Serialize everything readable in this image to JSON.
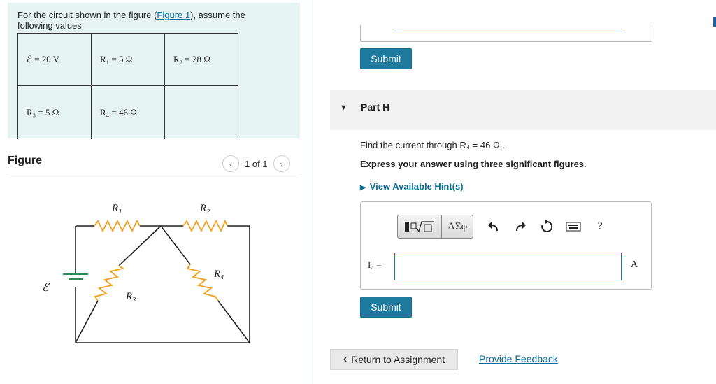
{
  "intro": {
    "text_before": "For the circuit shown in the figure (",
    "figure_link": "Figure 1",
    "text_after": "), assume the following values."
  },
  "values_table": [
    [
      "ℰ = 20 V",
      "R₁ = 5 Ω",
      "R₂ = 28 Ω"
    ],
    [
      "R₃ = 5 Ω",
      "R₄ = 46 Ω",
      ""
    ]
  ],
  "figure": {
    "label": "Figure",
    "pager_text": "1 of 1",
    "prev_icon": "chevron-left-icon",
    "next_icon": "chevron-right-icon",
    "circuit_labels": {
      "r1": "R₁",
      "r2": "R₂",
      "r3": "R₃",
      "r4": "R₄",
      "emf": "ℰ"
    }
  },
  "previous_part": {
    "submit_label": "Submit"
  },
  "part_h": {
    "title": "Part H",
    "question": "Find the current through R₄ = 46 Ω .",
    "instruction": "Express your answer using three significant figures.",
    "hints_label": "View Available Hint(s)",
    "toolbar": {
      "templates_icon": "fraction-sqrt-icon",
      "symbols_label": "ΑΣφ",
      "undo_icon": "undo-icon",
      "redo_icon": "redo-icon",
      "reset_icon": "reset-icon",
      "keyboard_icon": "keyboard-icon",
      "help_label": "?"
    },
    "variable_label": "I₄ =",
    "answer_value": "",
    "unit": "A",
    "submit_label": "Submit"
  },
  "footer": {
    "return_label": "Return to Assignment",
    "feedback_label": "Provide Feedback"
  },
  "colors": {
    "accent": "#1f7a9f",
    "link": "#0b6e99",
    "intro_bg": "#e6f4f4",
    "resistor": "#f0a020",
    "battery": "#2e8b57"
  }
}
